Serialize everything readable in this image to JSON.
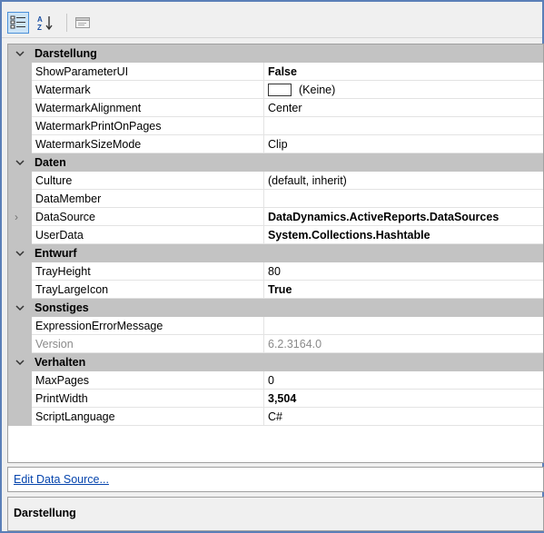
{
  "toolbar": {
    "buttons": [
      {
        "name": "categorized-view",
        "icon": "categorized-icon",
        "active": true
      },
      {
        "name": "alphabetical-view",
        "icon": "sort-az-icon",
        "active": false
      },
      {
        "name": "property-pages",
        "icon": "property-pages-icon",
        "active": false
      }
    ]
  },
  "grid": {
    "categories": [
      {
        "label": "Darstellung",
        "properties": [
          {
            "name": "ShowParameterUI",
            "value": "False",
            "bold": true
          },
          {
            "name": "Watermark",
            "value": "(Keine)",
            "swatch": "#ffffff"
          },
          {
            "name": "WatermarkAlignment",
            "value": "Center"
          },
          {
            "name": "WatermarkPrintOnPages",
            "value": ""
          },
          {
            "name": "WatermarkSizeMode",
            "value": "Clip"
          }
        ]
      },
      {
        "label": "Daten",
        "properties": [
          {
            "name": "Culture",
            "value": "(default, inherit)"
          },
          {
            "name": "DataMember",
            "value": ""
          },
          {
            "name": "DataSource",
            "value": "DataDynamics.ActiveReports.DataSources",
            "bold": true,
            "expandable": true
          },
          {
            "name": "UserData",
            "value": "System.Collections.Hashtable",
            "bold": true
          }
        ]
      },
      {
        "label": "Entwurf",
        "properties": [
          {
            "name": "TrayHeight",
            "value": "80"
          },
          {
            "name": "TrayLargeIcon",
            "value": "True",
            "bold": true
          }
        ]
      },
      {
        "label": "Sonstiges",
        "properties": [
          {
            "name": "ExpressionErrorMessage",
            "value": ""
          },
          {
            "name": "Version",
            "value": "6.2.3164.0",
            "disabled": true
          }
        ]
      },
      {
        "label": "Verhalten",
        "properties": [
          {
            "name": "MaxPages",
            "value": "0"
          },
          {
            "name": "PrintWidth",
            "value": "3,504",
            "bold": true
          },
          {
            "name": "ScriptLanguage",
            "value": "C#"
          }
        ]
      }
    ]
  },
  "commands": {
    "link": "Edit Data Source..."
  },
  "description": {
    "title": "Darstellung"
  },
  "colors": {
    "category_bg": "#c3c3c3",
    "link": "#0645ad",
    "border": "#5b7fb8"
  }
}
